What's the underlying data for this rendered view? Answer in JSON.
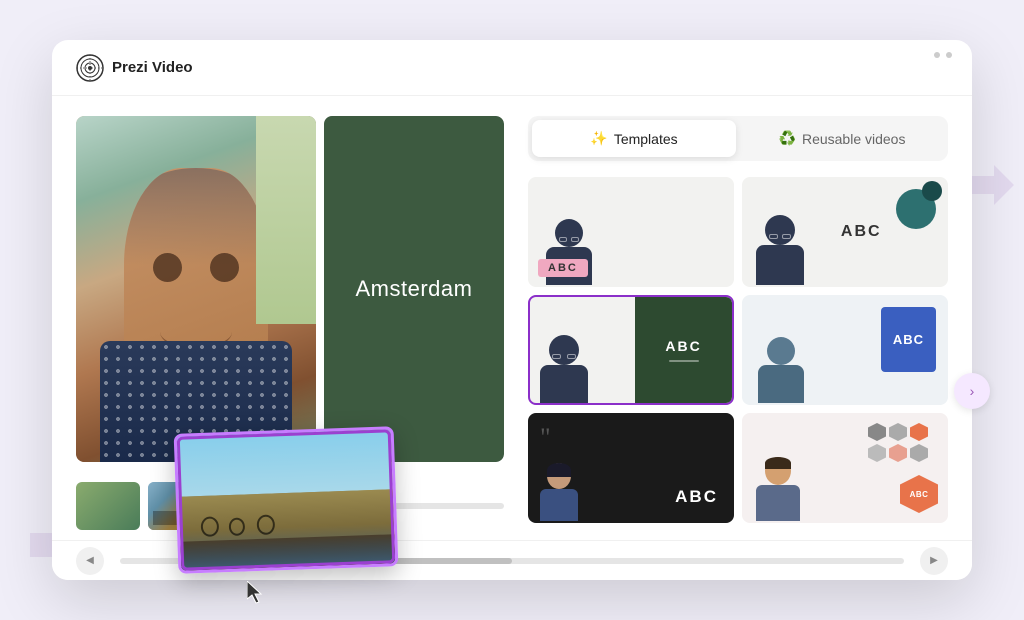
{
  "app": {
    "title": "Prezi Video",
    "logo_alt": "Prezi logo"
  },
  "tabs": {
    "templates_label": "Templates",
    "reusable_label": "Reusable videos",
    "active": "templates"
  },
  "preview": {
    "slide_title": "Amsterdam",
    "thumb_alt_1": "nature thumbnail",
    "thumb_alt_2": "amsterdam thumbnail"
  },
  "templates": {
    "cards": [
      {
        "id": 1,
        "style": "light-person",
        "label": "ABC",
        "selected": false
      },
      {
        "id": 2,
        "style": "person-dots",
        "label": "ABC",
        "selected": false
      },
      {
        "id": 3,
        "style": "person-dark-slide",
        "label": "ABC",
        "selected": true
      },
      {
        "id": 4,
        "style": "person-blue-rect",
        "label": "ABC",
        "selected": false
      },
      {
        "id": 5,
        "style": "dark-quote",
        "label": "ABC",
        "selected": false
      },
      {
        "id": 6,
        "style": "person-hex",
        "label": "ABC",
        "selected": false
      }
    ]
  },
  "footer": {
    "scroll_position": "20%"
  },
  "colors": {
    "accent_purple": "#8b2fc9",
    "accent_pink": "#e8d8f0",
    "slide_bg": "#3d5a40",
    "tab_active_bg": "#ffffff",
    "tab_inactive_bg": "transparent"
  }
}
